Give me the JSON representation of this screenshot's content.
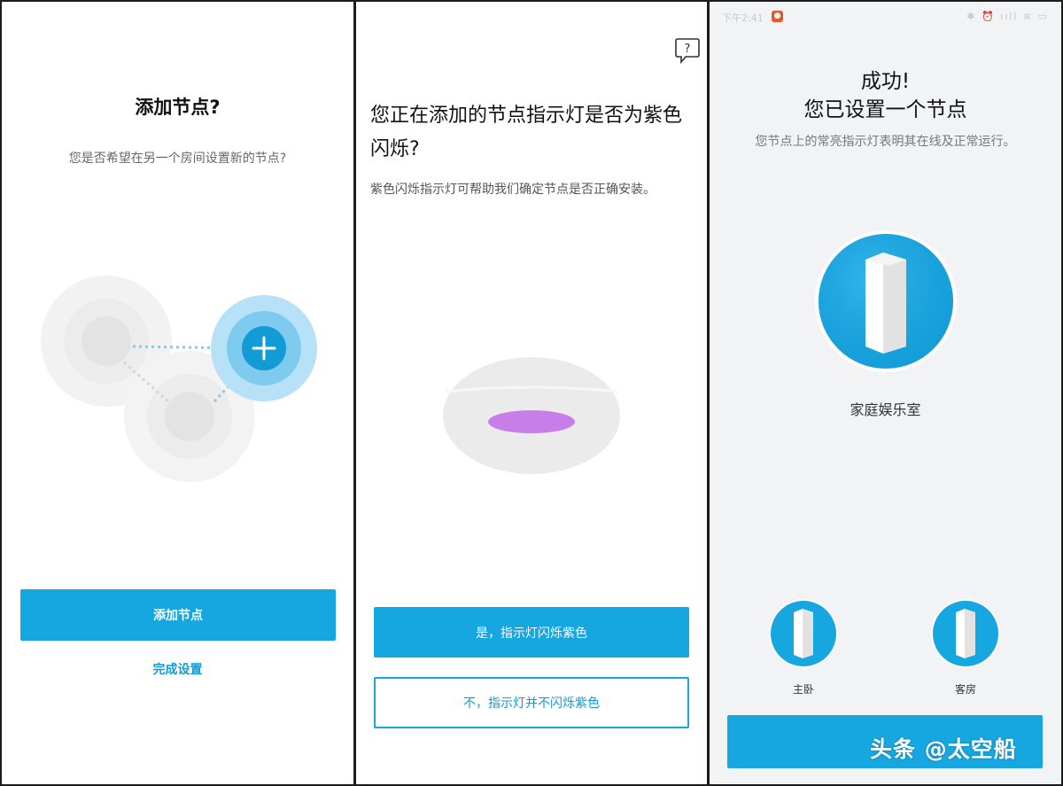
{
  "panel1": {
    "title": "添加节点?",
    "subtitle": "您是否希望在另一个房间设置新的节点?",
    "primary_button": "添加节点",
    "link": "完成设置"
  },
  "panel2": {
    "title": "您正在添加的节点指示灯是否为紫色闪烁?",
    "subtitle": "紫色闪烁指示灯可帮助我们确定节点是否正确安装。",
    "help_icon": "question-bubble-icon",
    "yes_button": "是，指示灯闪烁紫色",
    "no_button": "不，指示灯并不闪烁紫色"
  },
  "panel3": {
    "status_time": "下午2:41",
    "status_right": "✱ ⏰ ııll ≋ ▭",
    "title_line1": "成功!",
    "title_line2": "您已设置一个节点",
    "subtitle": "您节点上的常亮指示灯表明其在线及正常运行。",
    "main_room": "家庭娱乐室",
    "rooms": [
      "主卧",
      "客房"
    ]
  },
  "watermark": "头条 @太空船",
  "colors": {
    "accent": "#16a6e0",
    "purple_light": "#c77ee8",
    "background_dark": "#1c1c1c"
  }
}
